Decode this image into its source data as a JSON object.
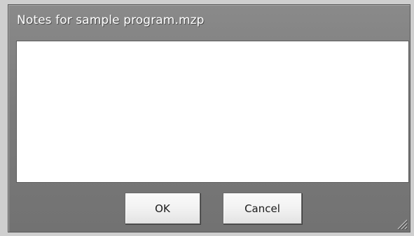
{
  "dialog": {
    "title": "Notes for sample program.mzp",
    "notes": {
      "value": "",
      "placeholder": ""
    },
    "buttons": {
      "ok_label": "OK",
      "cancel_label": "Cancel"
    }
  },
  "icons": {
    "resize_grip": "resize-grip-icon"
  },
  "colors": {
    "dialog_background": "#7b7b7b",
    "title_text": "#ffffff",
    "notes_background": "#ffffff",
    "button_face": "#f2f2f2"
  }
}
